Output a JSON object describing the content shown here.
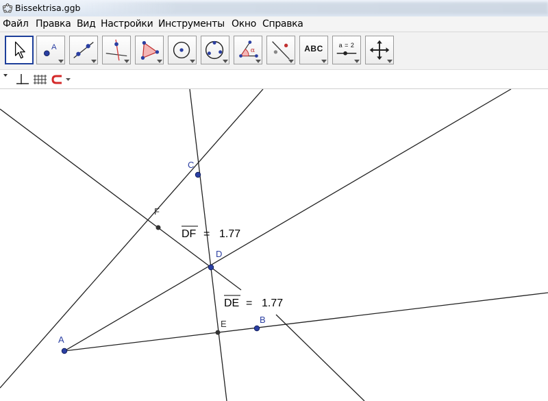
{
  "window": {
    "title": "Bissektrisa.ggb"
  },
  "menu": {
    "items": [
      "Файл",
      "Правка",
      "Вид",
      "Настройки",
      "Инструменты",
      "Окно",
      "Справка"
    ]
  },
  "toolbar": {
    "tools": [
      {
        "name": "move-tool-button",
        "icon": "pointer-arrow-icon",
        "selected": true
      },
      {
        "name": "point-tool-button",
        "icon": "point-icon"
      },
      {
        "name": "line-tool-button",
        "icon": "line-through-points-icon"
      },
      {
        "name": "perpendicular-line-tool-button",
        "icon": "perpendicular-line-icon"
      },
      {
        "name": "polygon-tool-button",
        "icon": "polygon-icon"
      },
      {
        "name": "circle-tool-button",
        "icon": "circle-center-point-icon"
      },
      {
        "name": "circle-three-points-tool-button",
        "icon": "circle-three-points-icon"
      },
      {
        "name": "angle-tool-button",
        "icon": "angle-icon"
      },
      {
        "name": "reflect-tool-button",
        "icon": "reflect-about-line-icon"
      },
      {
        "name": "text-tool-button",
        "icon": "text-icon",
        "label": "ABC"
      },
      {
        "name": "slider-tool-button",
        "icon": "slider-icon",
        "label": "a = 2"
      },
      {
        "name": "move-graphics-view-tool-button",
        "icon": "move-arrows-icon"
      }
    ]
  },
  "stylebar": {
    "items": [
      "axes-toggle-icon",
      "grid-toggle-icon",
      "point-capturing-magnet-icon"
    ]
  },
  "canvas": {
    "points": [
      {
        "label": "A",
        "color": "#2b3fa2"
      },
      {
        "label": "B",
        "color": "#2b3fa2"
      },
      {
        "label": "C",
        "color": "#2b3fa2"
      },
      {
        "label": "D",
        "color": "#2b3fa2"
      },
      {
        "label": "E",
        "color": "#333333"
      },
      {
        "label": "F",
        "color": "#333333"
      }
    ],
    "measurements": [
      {
        "segment": "DF",
        "equals": "=",
        "value": "1.77"
      },
      {
        "segment": "DE",
        "equals": "=",
        "value": "1.77"
      }
    ]
  },
  "colors": {
    "point_free": "#2b3fa2",
    "point_dependent": "#333333",
    "line": "#222222",
    "selected_border": "#1d3f9a"
  }
}
